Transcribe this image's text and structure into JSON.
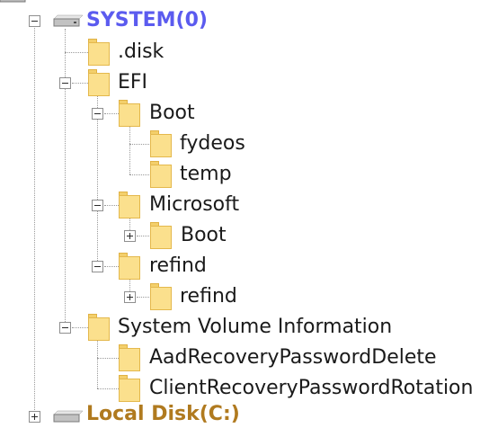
{
  "tree": {
    "root_label": "SYSTEM(0)",
    "next_root_label": "Local Disk(C:)",
    "items": [
      {
        "label": ".disk"
      },
      {
        "label": "EFI"
      },
      {
        "label": "Boot"
      },
      {
        "label": "fydeos"
      },
      {
        "label": "temp"
      },
      {
        "label": "Microsoft"
      },
      {
        "label": "Boot"
      },
      {
        "label": "refind"
      },
      {
        "label": "refind"
      },
      {
        "label": "System Volume Information"
      },
      {
        "label": "AadRecoveryPasswordDelete"
      },
      {
        "label": "ClientRecoveryPasswordRotation"
      }
    ]
  },
  "icons": {
    "drive": "hard-drive-icon",
    "folder": "folder-icon",
    "expand": "plus-box-icon",
    "collapse": "minus-box-icon"
  },
  "colors": {
    "root_text": "#5b5bef",
    "folder_fill": "#fbe08d",
    "connector": "#9a9a9a"
  }
}
